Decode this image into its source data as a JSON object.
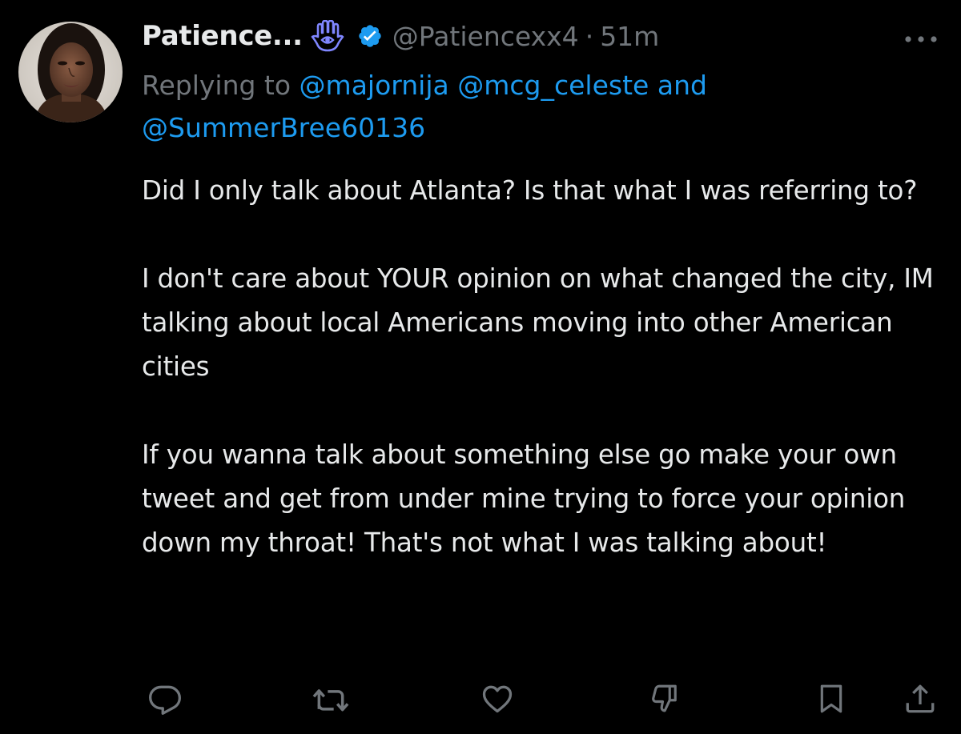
{
  "tweet": {
    "display_name": "Patience...",
    "handle": "@Patiencexx4",
    "separator": "·",
    "time": "51m",
    "avatar_icon": "profile-photo",
    "name_emoji_icon": "hamsa-icon",
    "verified_icon": "verified-badge-icon",
    "more_icon": "more-icon",
    "replying_prefix": "Replying to",
    "replying_mentions": [
      "@majornija",
      "@mcg_celeste"
    ],
    "replying_and": "and",
    "replying_last": "@SummerBree60136",
    "body_paragraphs": [
      "Did I only talk about Atlanta? Is that what I was referring to?",
      "I don't care about YOUR opinion on what changed the city, IM talking about local Americans moving into other American cities",
      "If you wanna talk about something else go make your own tweet and get from under mine trying to force your opinion down my throat! That's not what I was talking about!"
    ]
  },
  "actions": [
    {
      "name": "reply",
      "icon": "reply-icon"
    },
    {
      "name": "retweet",
      "icon": "retweet-icon"
    },
    {
      "name": "like",
      "icon": "heart-icon"
    },
    {
      "name": "dislike",
      "icon": "thumbs-down-icon"
    },
    {
      "name": "bookmark",
      "icon": "bookmark-icon"
    },
    {
      "name": "share",
      "icon": "share-icon"
    }
  ],
  "colors": {
    "background": "#000000",
    "text_primary": "#e7e9ea",
    "text_secondary": "#71767b",
    "link": "#1d9bf0",
    "verified": "#1d9bf0",
    "hamsa": "#7f86ff"
  }
}
